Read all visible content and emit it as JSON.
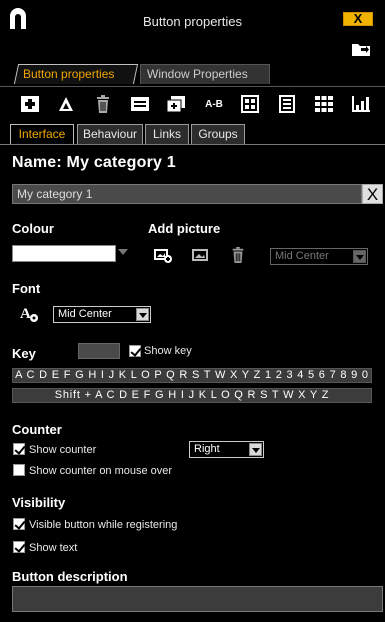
{
  "window": {
    "title": "Button properties",
    "close_label": "X",
    "accent_color": "#f0a500"
  },
  "window_tabs": [
    {
      "label": "Button properties",
      "active": true
    },
    {
      "label": "Window Properties",
      "active": false
    }
  ],
  "toolbar": {
    "tools": [
      {
        "icon": "add-button-icon"
      },
      {
        "icon": "triangle-icon"
      },
      {
        "icon": "trash-icon"
      },
      {
        "icon": "button-layout-icon"
      },
      {
        "icon": "copy-button-icon"
      },
      {
        "icon": "ab-text-icon",
        "text": "A-B"
      },
      {
        "icon": "grid-layout-icon"
      },
      {
        "icon": "page-layout-icon"
      },
      {
        "icon": "grid-icon"
      },
      {
        "icon": "bar-chart-icon"
      }
    ]
  },
  "inner_tabs": [
    {
      "label": "Interface",
      "active": true
    },
    {
      "label": "Behaviour",
      "active": false
    },
    {
      "label": "Links",
      "active": false
    },
    {
      "label": "Groups",
      "active": false
    }
  ],
  "name": {
    "heading": "Name: My category 1",
    "value": "My category 1",
    "clear_label": "X"
  },
  "colour": {
    "label": "Colour",
    "value": "#ffffff"
  },
  "add_picture": {
    "label": "Add picture",
    "position": "Mid Center"
  },
  "font": {
    "label": "Font",
    "position": "Mid Center"
  },
  "key": {
    "label": "Key",
    "show_key_label": "Show key",
    "show_key_checked": true,
    "keys_row": "A C D E F G H I J K L O P Q R S T W X Y Z 1 2 3 4 5 6 7 8 9 0",
    "shift_row": "Shift + A C D E F G H I J K L O Q R S T W X Y Z"
  },
  "counter": {
    "label": "Counter",
    "show_counter_label": "Show counter",
    "show_counter_checked": true,
    "counter_position": "Right",
    "show_on_mouse_over_label": "Show counter on mouse over",
    "show_on_mouse_over_checked": false
  },
  "visibility": {
    "label": "Visibility",
    "visible_while_registering_label": "Visible button while registering",
    "visible_while_registering_checked": true,
    "show_text_label": "Show text",
    "show_text_checked": true
  },
  "description": {
    "label": "Button description",
    "value": ""
  }
}
